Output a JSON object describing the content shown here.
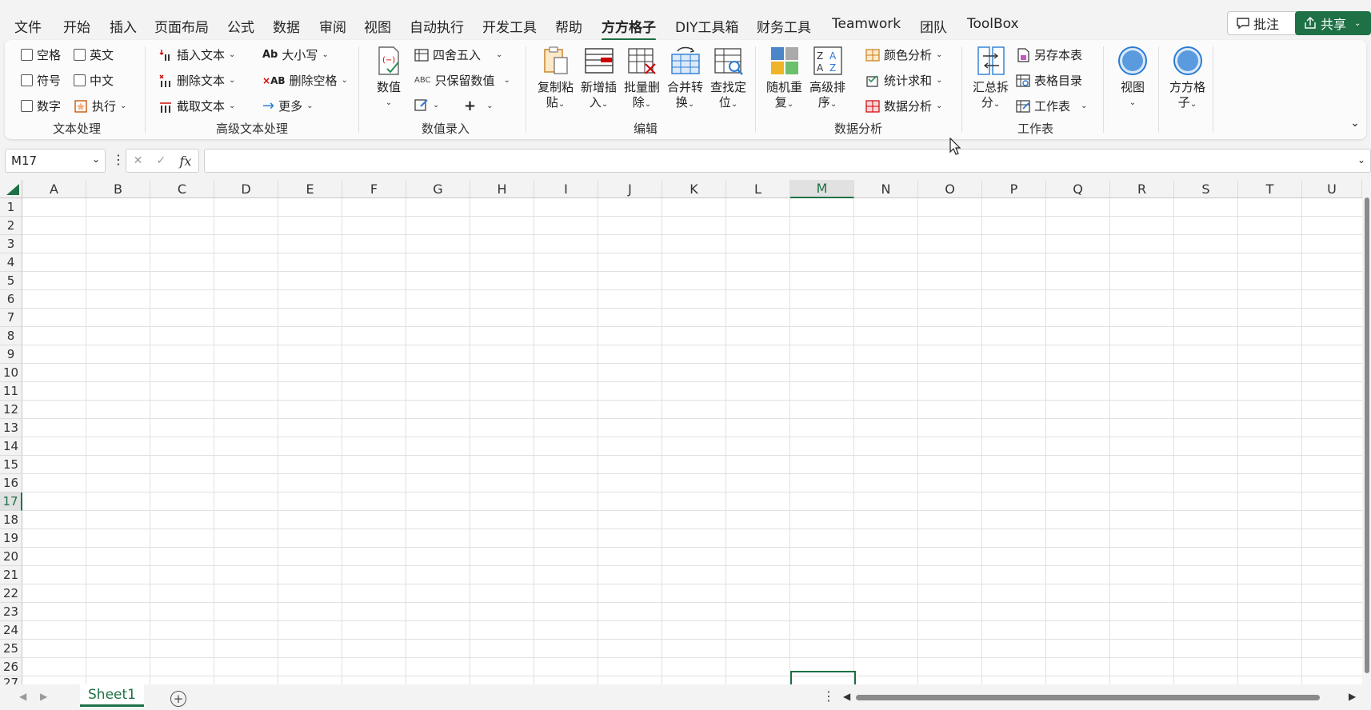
{
  "menu": {
    "tabs": [
      "文件",
      "开始",
      "插入",
      "页面布局",
      "公式",
      "数据",
      "审阅",
      "视图",
      "自动执行",
      "开发工具",
      "帮助",
      "方方格子",
      "DIY工具箱",
      "财务工具",
      "Teamwork",
      "团队",
      "ToolBox"
    ],
    "active_tab": "方方格子",
    "comment_label": "批注",
    "share_label": "共享"
  },
  "ribbon": {
    "text_processing": {
      "label": "文本处理",
      "checkboxes": [
        "空格",
        "英文",
        "符号",
        "中文",
        "数字"
      ],
      "execute_label": "执行"
    },
    "advanced_text": {
      "label": "高级文本处理",
      "insert_text": "插入文本",
      "delete_text": "删除文本",
      "extract_text": "截取文本",
      "case": "大小写",
      "delete_space": "删除空格",
      "more": "更多"
    },
    "value_entry": {
      "label": "数值录入",
      "value": "数值",
      "round": "四舍五入",
      "keep_value": "只保留数值"
    },
    "edit": {
      "label": "编辑",
      "copy_paste": [
        "复制粘",
        "贴"
      ],
      "new_insert": [
        "新增插",
        "入"
      ],
      "batch_delete": [
        "批量删",
        "除"
      ],
      "merge_convert": [
        "合并转",
        "换"
      ],
      "find_locate": [
        "查找定",
        "位"
      ]
    },
    "data_analysis": {
      "label": "数据分析",
      "random_repeat": [
        "随机重",
        "复"
      ],
      "advanced_sort": [
        "高级排",
        "序"
      ],
      "color_analysis": "颜色分析",
      "stat_sum": "统计求和",
      "data_analysis": "数据分析"
    },
    "worksheet": {
      "label": "工作表",
      "summary_split": [
        "汇总拆",
        "分"
      ],
      "save_sheet": "另存本表",
      "sheet_index": "表格目录",
      "worksheet": "工作表"
    },
    "view": "视图",
    "ffgz": [
      "方方格",
      "子"
    ]
  },
  "formula_bar": {
    "name_box": "M17",
    "fx": "fx",
    "value": ""
  },
  "grid": {
    "columns": [
      "A",
      "B",
      "C",
      "D",
      "E",
      "F",
      "G",
      "H",
      "I",
      "J",
      "K",
      "L",
      "M",
      "N",
      "O",
      "P",
      "Q",
      "R",
      "S",
      "T",
      "U"
    ],
    "rows": [
      "1",
      "2",
      "3",
      "4",
      "5",
      "6",
      "7",
      "8",
      "9",
      "10",
      "11",
      "12",
      "13",
      "14",
      "15",
      "16",
      "17",
      "18",
      "19",
      "20",
      "21",
      "22",
      "23",
      "24",
      "25",
      "26",
      "27"
    ],
    "selected_column": "M",
    "selected_row": "17"
  },
  "sheets": {
    "tabs": [
      "Sheet1"
    ],
    "active": "Sheet1"
  },
  "colors": {
    "accent": "#1e7145"
  }
}
